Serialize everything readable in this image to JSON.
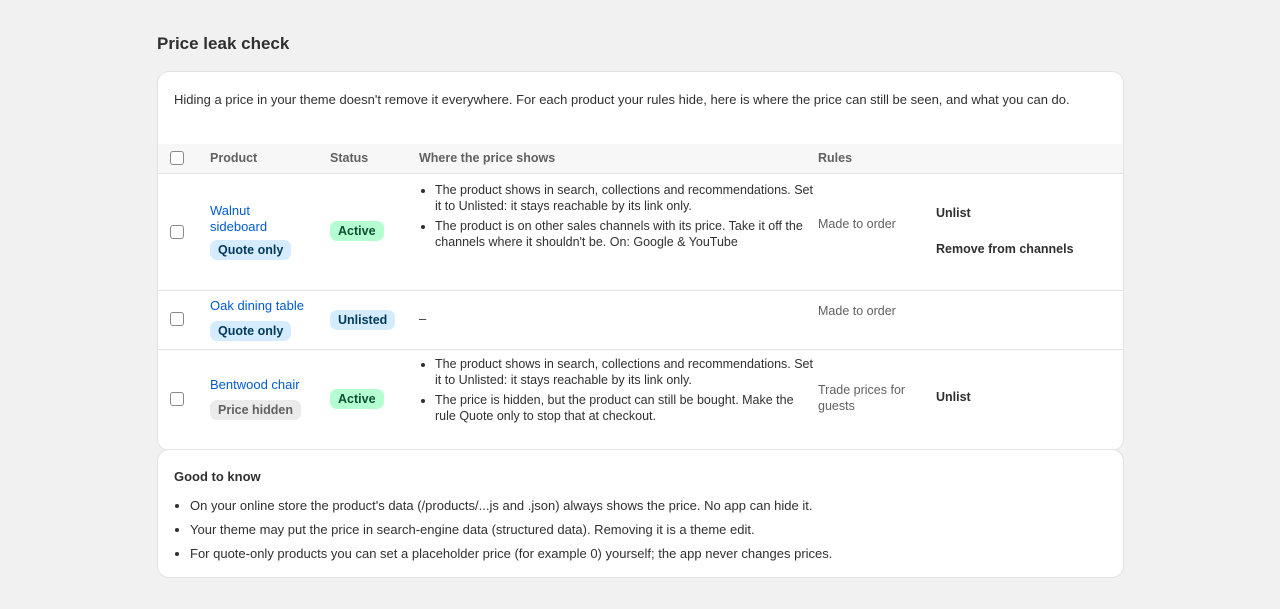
{
  "page": {
    "title": "Price leak check"
  },
  "intro": "Hiding a price in your theme doesn't remove it everywhere. For each product your rules hide, here is where the price can still be seen, and what you can do.",
  "table": {
    "headers": {
      "product": "Product",
      "status": "Status",
      "where": "Where the price shows",
      "rules": "Rules"
    },
    "rows": [
      {
        "product": "Walnut sideboard",
        "tag": "Quote only",
        "status": "Active",
        "where": [
          "The product shows in search, collections and recommendations. Set it to Unlisted: it stays reachable by its link only.",
          "The product is on other sales channels with its price. Take it off the channels where it shouldn't be. On: Google & YouTube"
        ],
        "rules": "Made to order",
        "actions": [
          "Unlist",
          "Remove from channels"
        ]
      },
      {
        "product": "Oak dining table",
        "tag": "Quote only",
        "status": "Unlisted",
        "where_empty": "–",
        "rules": "Made to order",
        "actions": []
      },
      {
        "product": "Bentwood chair",
        "tag": "Price hidden",
        "status": "Active",
        "where": [
          "The product shows in search, collections and recommendations. Set it to Unlisted: it stays reachable by its link only.",
          "The price is hidden, but the product can still be bought. Make the rule Quote only to stop that at checkout."
        ],
        "rules": "Trade prices for guests",
        "actions": [
          "Unlist"
        ]
      }
    ]
  },
  "info": {
    "title": "Good to know",
    "items": [
      "On your online store the product's data (/products/...js and .json) always shows the price. No app can hide it.",
      "Your theme may put the price in search-engine data (structured data). Removing it is a theme edit.",
      "For quote-only products you can set a placeholder price (for example 0) yourself; the app never changes prices."
    ]
  },
  "colors": {
    "link": "#005bd3",
    "active_badge": "#b4fed2",
    "quote_badge": "#d5ebff",
    "hidden_badge": "#ebebeb"
  }
}
